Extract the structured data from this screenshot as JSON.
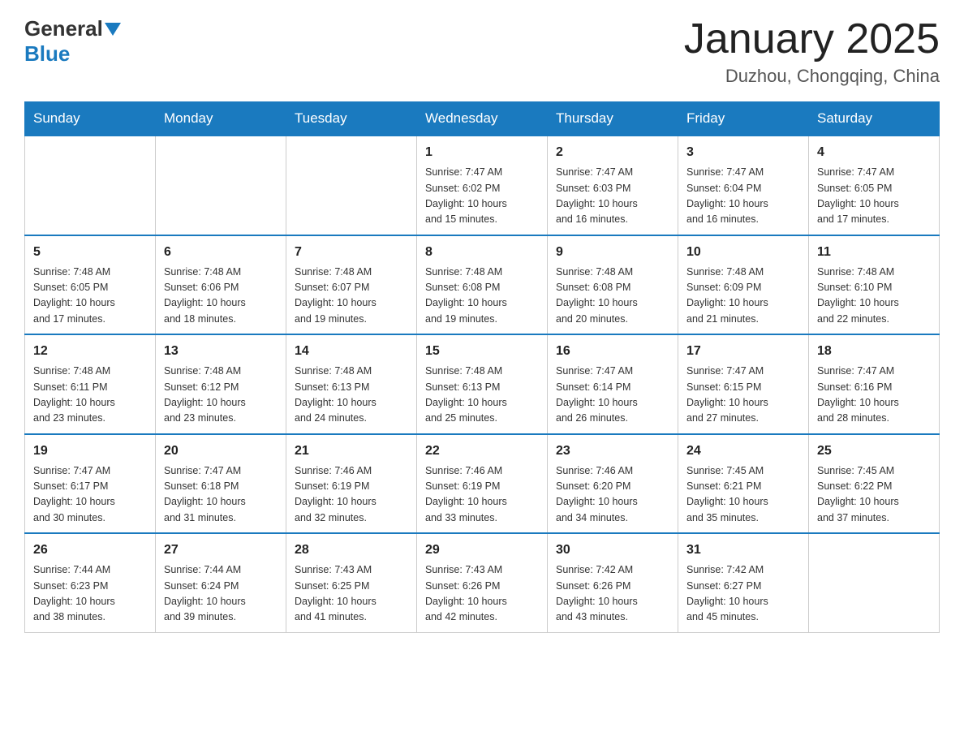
{
  "header": {
    "logo_general": "General",
    "logo_blue": "Blue",
    "month_title": "January 2025",
    "location": "Duzhou, Chongqing, China"
  },
  "days_of_week": [
    "Sunday",
    "Monday",
    "Tuesday",
    "Wednesday",
    "Thursday",
    "Friday",
    "Saturday"
  ],
  "weeks": [
    [
      {
        "day": "",
        "info": ""
      },
      {
        "day": "",
        "info": ""
      },
      {
        "day": "",
        "info": ""
      },
      {
        "day": "1",
        "info": "Sunrise: 7:47 AM\nSunset: 6:02 PM\nDaylight: 10 hours\nand 15 minutes."
      },
      {
        "day": "2",
        "info": "Sunrise: 7:47 AM\nSunset: 6:03 PM\nDaylight: 10 hours\nand 16 minutes."
      },
      {
        "day": "3",
        "info": "Sunrise: 7:47 AM\nSunset: 6:04 PM\nDaylight: 10 hours\nand 16 minutes."
      },
      {
        "day": "4",
        "info": "Sunrise: 7:47 AM\nSunset: 6:05 PM\nDaylight: 10 hours\nand 17 minutes."
      }
    ],
    [
      {
        "day": "5",
        "info": "Sunrise: 7:48 AM\nSunset: 6:05 PM\nDaylight: 10 hours\nand 17 minutes."
      },
      {
        "day": "6",
        "info": "Sunrise: 7:48 AM\nSunset: 6:06 PM\nDaylight: 10 hours\nand 18 minutes."
      },
      {
        "day": "7",
        "info": "Sunrise: 7:48 AM\nSunset: 6:07 PM\nDaylight: 10 hours\nand 19 minutes."
      },
      {
        "day": "8",
        "info": "Sunrise: 7:48 AM\nSunset: 6:08 PM\nDaylight: 10 hours\nand 19 minutes."
      },
      {
        "day": "9",
        "info": "Sunrise: 7:48 AM\nSunset: 6:08 PM\nDaylight: 10 hours\nand 20 minutes."
      },
      {
        "day": "10",
        "info": "Sunrise: 7:48 AM\nSunset: 6:09 PM\nDaylight: 10 hours\nand 21 minutes."
      },
      {
        "day": "11",
        "info": "Sunrise: 7:48 AM\nSunset: 6:10 PM\nDaylight: 10 hours\nand 22 minutes."
      }
    ],
    [
      {
        "day": "12",
        "info": "Sunrise: 7:48 AM\nSunset: 6:11 PM\nDaylight: 10 hours\nand 23 minutes."
      },
      {
        "day": "13",
        "info": "Sunrise: 7:48 AM\nSunset: 6:12 PM\nDaylight: 10 hours\nand 23 minutes."
      },
      {
        "day": "14",
        "info": "Sunrise: 7:48 AM\nSunset: 6:13 PM\nDaylight: 10 hours\nand 24 minutes."
      },
      {
        "day": "15",
        "info": "Sunrise: 7:48 AM\nSunset: 6:13 PM\nDaylight: 10 hours\nand 25 minutes."
      },
      {
        "day": "16",
        "info": "Sunrise: 7:47 AM\nSunset: 6:14 PM\nDaylight: 10 hours\nand 26 minutes."
      },
      {
        "day": "17",
        "info": "Sunrise: 7:47 AM\nSunset: 6:15 PM\nDaylight: 10 hours\nand 27 minutes."
      },
      {
        "day": "18",
        "info": "Sunrise: 7:47 AM\nSunset: 6:16 PM\nDaylight: 10 hours\nand 28 minutes."
      }
    ],
    [
      {
        "day": "19",
        "info": "Sunrise: 7:47 AM\nSunset: 6:17 PM\nDaylight: 10 hours\nand 30 minutes."
      },
      {
        "day": "20",
        "info": "Sunrise: 7:47 AM\nSunset: 6:18 PM\nDaylight: 10 hours\nand 31 minutes."
      },
      {
        "day": "21",
        "info": "Sunrise: 7:46 AM\nSunset: 6:19 PM\nDaylight: 10 hours\nand 32 minutes."
      },
      {
        "day": "22",
        "info": "Sunrise: 7:46 AM\nSunset: 6:19 PM\nDaylight: 10 hours\nand 33 minutes."
      },
      {
        "day": "23",
        "info": "Sunrise: 7:46 AM\nSunset: 6:20 PM\nDaylight: 10 hours\nand 34 minutes."
      },
      {
        "day": "24",
        "info": "Sunrise: 7:45 AM\nSunset: 6:21 PM\nDaylight: 10 hours\nand 35 minutes."
      },
      {
        "day": "25",
        "info": "Sunrise: 7:45 AM\nSunset: 6:22 PM\nDaylight: 10 hours\nand 37 minutes."
      }
    ],
    [
      {
        "day": "26",
        "info": "Sunrise: 7:44 AM\nSunset: 6:23 PM\nDaylight: 10 hours\nand 38 minutes."
      },
      {
        "day": "27",
        "info": "Sunrise: 7:44 AM\nSunset: 6:24 PM\nDaylight: 10 hours\nand 39 minutes."
      },
      {
        "day": "28",
        "info": "Sunrise: 7:43 AM\nSunset: 6:25 PM\nDaylight: 10 hours\nand 41 minutes."
      },
      {
        "day": "29",
        "info": "Sunrise: 7:43 AM\nSunset: 6:26 PM\nDaylight: 10 hours\nand 42 minutes."
      },
      {
        "day": "30",
        "info": "Sunrise: 7:42 AM\nSunset: 6:26 PM\nDaylight: 10 hours\nand 43 minutes."
      },
      {
        "day": "31",
        "info": "Sunrise: 7:42 AM\nSunset: 6:27 PM\nDaylight: 10 hours\nand 45 minutes."
      },
      {
        "day": "",
        "info": ""
      }
    ]
  ]
}
